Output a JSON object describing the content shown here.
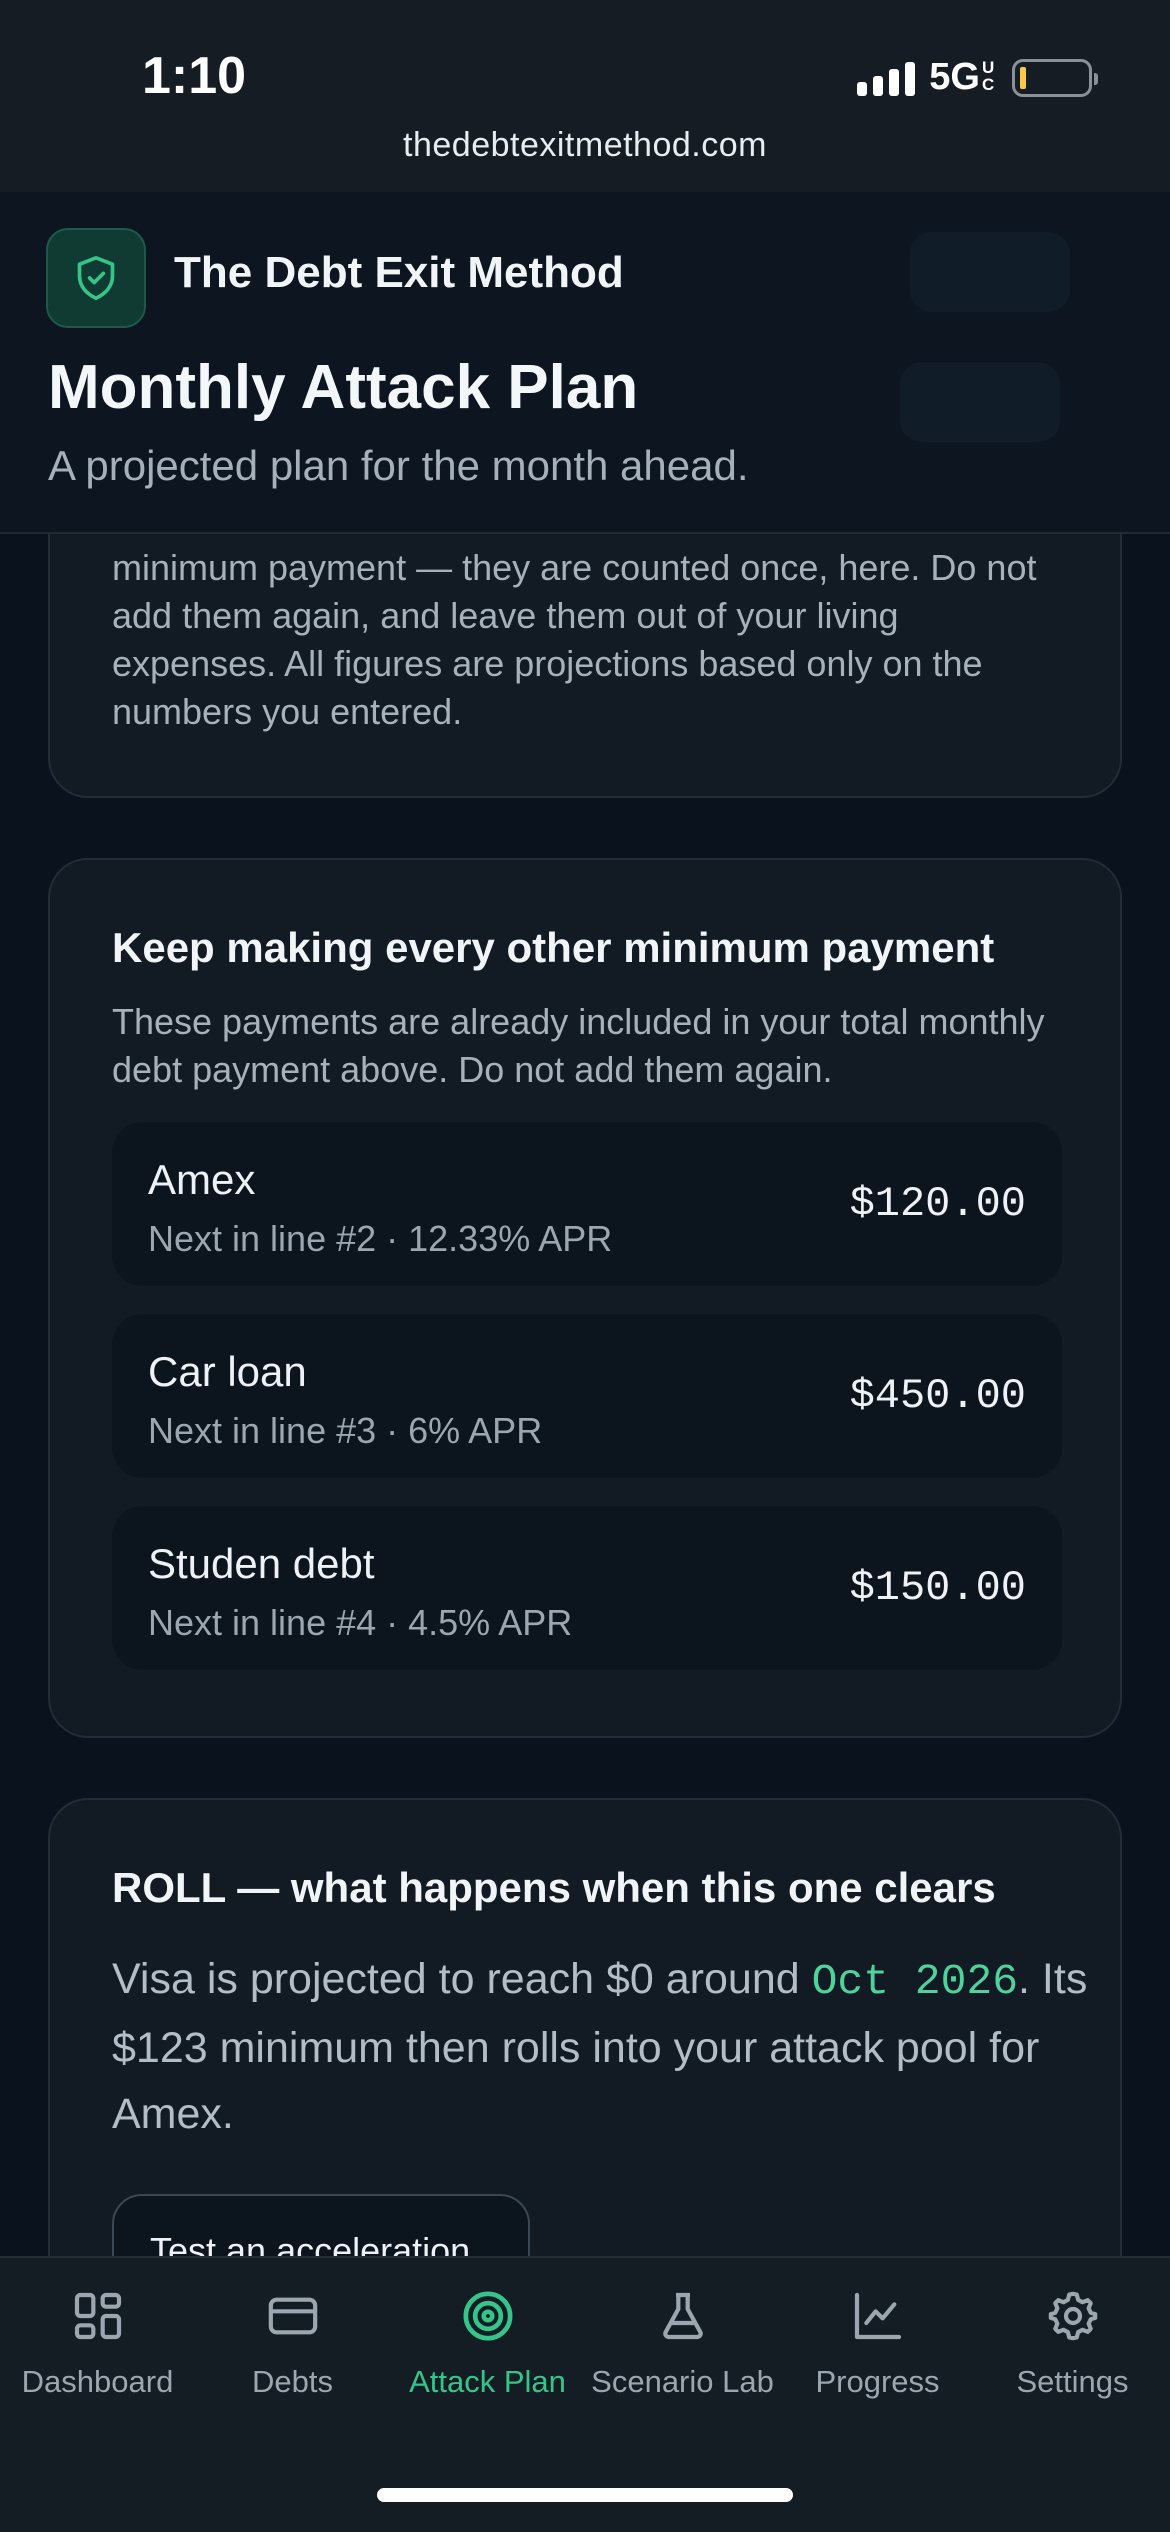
{
  "status_bar": {
    "time": "1:10",
    "network": "5G",
    "network_sup": "UC",
    "url": "thedebtexitmethod.com"
  },
  "header": {
    "brand": "The Debt Exit Method",
    "page_title": "Monthly Attack Plan",
    "page_subtitle": "A projected plan for the month ahead."
  },
  "note_card": {
    "text": "minimum payment — they are counted once, here. Do not add them again, and leave them out of your living expenses. All figures are projections based only on the numbers you entered."
  },
  "minimums_card": {
    "title": "Keep making every other minimum payment",
    "description": "These payments are already included in your total monthly debt payment above. Do not add them again.",
    "debts": [
      {
        "name": "Amex",
        "meta": "Next in line #2 · 12.33% APR",
        "amount": "$120.00"
      },
      {
        "name": "Car loan",
        "meta": "Next in line #3 · 6% APR",
        "amount": "$450.00"
      },
      {
        "name": "Studen debt",
        "meta": "Next in line #4 · 4.5% APR",
        "amount": "$150.00"
      }
    ]
  },
  "roll_card": {
    "title": "ROLL — what happens when this one clears",
    "text_before": "Visa is projected to reach $0 around ",
    "date": "Oct 2026",
    "text_after": ". Its $123 minimum then rolls into your attack pool for Amex.",
    "button_label": "Test an acceleration"
  },
  "nav": {
    "items": [
      {
        "label": "Dashboard",
        "icon": "grid-icon"
      },
      {
        "label": "Debts",
        "icon": "card-icon"
      },
      {
        "label": "Attack Plan",
        "icon": "target-icon",
        "active": true
      },
      {
        "label": "Scenario Lab",
        "icon": "flask-icon"
      },
      {
        "label": "Progress",
        "icon": "chart-icon"
      },
      {
        "label": "Settings",
        "icon": "gear-icon"
      }
    ]
  },
  "colors": {
    "accent": "#35c489",
    "background": "#0a131d",
    "card": "#121a24"
  }
}
